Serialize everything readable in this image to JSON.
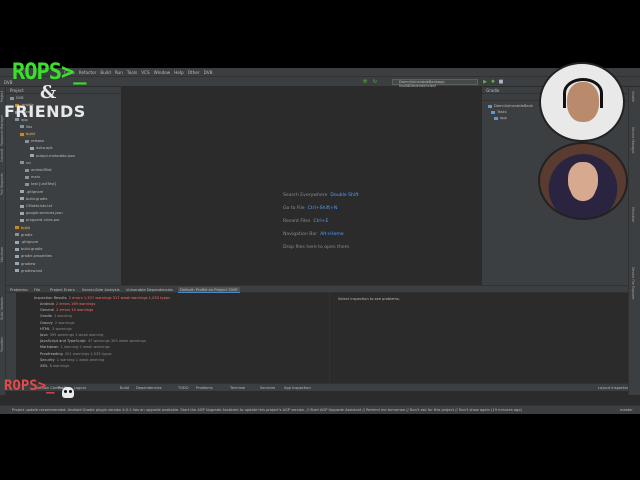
{
  "menu": [
    "Code",
    "Refactor",
    "Build",
    "Run",
    "Tools",
    "VCS",
    "Window",
    "Help",
    "Other",
    "DVB"
  ],
  "toolbar": {
    "project_path": "DVB",
    "run_config": "DamnVulnerableBankapp [buildDependencies]"
  },
  "left_stripe_tabs": [
    "Project",
    "Resource Manager",
    "Commit",
    "Pull Requests",
    "Structure",
    "Build Variants",
    "Favorites"
  ],
  "right_stripe_tabs": [
    "Gradle",
    "Device Manager",
    "Emulator",
    "Device File Explorer"
  ],
  "project_panel": {
    "header": "Project",
    "rows": [
      {
        "label": "DVB",
        "kind": "folder"
      },
      {
        "label": ".gradle",
        "kind": "folder-orange"
      },
      {
        "label": ".idea",
        "kind": "folder"
      },
      {
        "label": "app",
        "kind": "folder"
      },
      {
        "label": "libs",
        "kind": "folder"
      },
      {
        "label": "build",
        "kind": "folder-orange"
      },
      {
        "label": "release",
        "kind": "folder"
      },
      {
        "label": "dvba.apk",
        "kind": "file"
      },
      {
        "label": "output-metadata.json",
        "kind": "file"
      },
      {
        "label": "src",
        "kind": "folder"
      },
      {
        "label": "androidTest",
        "kind": "folder"
      },
      {
        "label": "main",
        "kind": "folder"
      },
      {
        "label": "test [unitTest]",
        "kind": "folder"
      },
      {
        "label": ".gitignore",
        "kind": "file"
      },
      {
        "label": "build.gradle",
        "kind": "file"
      },
      {
        "label": "CMakeLists.txt",
        "kind": "file"
      },
      {
        "label": "google-services.json",
        "kind": "file"
      },
      {
        "label": "proguard-rules.pro",
        "kind": "file"
      },
      {
        "label": "build",
        "kind": "folder-orange"
      },
      {
        "label": "gradle",
        "kind": "folder"
      },
      {
        "label": ".gitignore",
        "kind": "file"
      },
      {
        "label": "build.gradle",
        "kind": "file"
      },
      {
        "label": "gradle.properties",
        "kind": "file"
      },
      {
        "label": "gradlew",
        "kind": "file"
      },
      {
        "label": "gradlew.bat",
        "kind": "file"
      }
    ]
  },
  "editor_hints": [
    {
      "text": "Search Everywhere",
      "key": "Double Shift"
    },
    {
      "text": "Go to File",
      "key": "Ctrl+Shift+N"
    },
    {
      "text": "Recent Files",
      "key": "Ctrl+E"
    },
    {
      "text": "Navigation Bar",
      "key": "Alt+Home"
    },
    {
      "text": "Drop files here to open them",
      "key": ""
    }
  ],
  "gradle_panel": {
    "header": "Gradle",
    "rows": [
      "DamnVulnerableBank",
      "Tasks",
      "app"
    ]
  },
  "problems_tabs": [
    "Problems:",
    "File",
    "Project Errors",
    "Server-Side Analysis",
    "Vulnerable Dependencies",
    "Default: Profile on Project 'DVB'"
  ],
  "problems": {
    "root": "Inspection Results",
    "root_count": "2 errors  1,337 warnings  317 weak warnings  1,033 typos",
    "items": [
      {
        "label": "Android",
        "count": "2 errors  169 warnings"
      },
      {
        "label": "General",
        "count": "2 errors  10 warnings"
      },
      {
        "label": "Gradle",
        "count": "1 warning"
      },
      {
        "label": "Groovy",
        "count": "2 warnings"
      },
      {
        "label": "HTML",
        "count": "3 warnings"
      },
      {
        "label": "Java",
        "count": "395 warnings  1 weak warning"
      },
      {
        "label": "JavaScript and TypeScript",
        "count": "47 warnings  305 weak warnings"
      },
      {
        "label": "Markdown",
        "count": "1 warning  2 weak warnings"
      },
      {
        "label": "Proofreading",
        "count": "201 warnings  1,033 typos"
      },
      {
        "label": "Security",
        "count": "1 warning  1 weak warning"
      },
      {
        "label": "XML",
        "count": "8 warnings"
      }
    ],
    "right_text": "Select inspection to see problems."
  },
  "bottom_tools": [
    "Version Control",
    "Profiler",
    "Logcat",
    "Build",
    "Dependencies",
    "TODO",
    "Problems",
    "Terminal",
    "Services",
    "App Inspection",
    "Layout Inspector"
  ],
  "status": {
    "message": "Project update recommended: Android Gradle plugin version 4.0.1 has an upgrade available. Start the AGP Upgrade Assistant to update this project's AGP version. // Start AGP Upgrade Assistant // Remind me tomorrow // Don't ask for this project // Don't show again (19 minutes ago)",
    "right": "master"
  },
  "overlay": {
    "logo_top": "ROPS>_",
    "logo_amp": "&",
    "logo_bottom": "FRIENDS",
    "mini_logo": "ROPS>_"
  },
  "colors": {
    "ide_bg": "#2b2b2b",
    "panel_bg": "#3c3f41",
    "accent_blue": "#589df6",
    "logo_green": "#3be02a",
    "error_red": "#ff6b68"
  }
}
